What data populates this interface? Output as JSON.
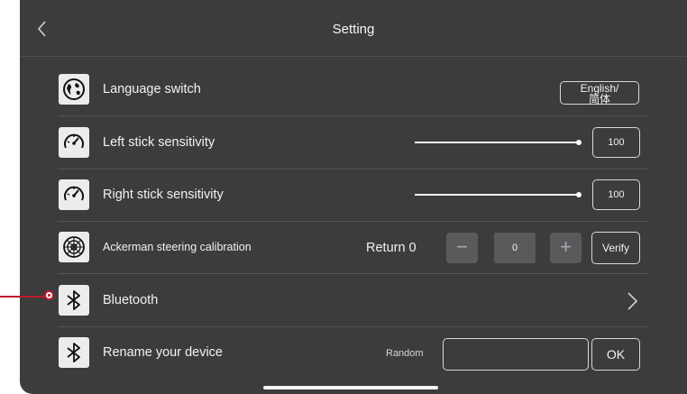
{
  "header": {
    "title": "Setting",
    "back_icon": "chevron-left-icon"
  },
  "rows": {
    "language": {
      "icon": "globe-icon",
      "label": "Language switch",
      "button_label": "English/\n简体"
    },
    "left_stick": {
      "icon": "speedometer-icon",
      "label": "Left stick sensitivity",
      "slider_value": 1.0,
      "value": "100"
    },
    "right_stick": {
      "icon": "speedometer-icon",
      "label": "Right stick sensitivity",
      "slider_value": 1.0,
      "value": "100"
    },
    "ackerman": {
      "icon": "steering-wheel-icon",
      "label": "Ackerman steering calibration",
      "return_label": "Return 0",
      "minus": "−",
      "value": "0",
      "plus": "+",
      "verify_label": "Verify"
    },
    "bluetooth": {
      "icon": "bluetooth-icon",
      "label": "Bluetooth",
      "chevron_icon": "chevron-right-icon"
    },
    "rename": {
      "icon": "bluetooth-icon",
      "label": "Rename your device",
      "random_label": "Random",
      "input_value": "",
      "ok_label": "OK"
    }
  },
  "colors": {
    "background": "#3c3c3e",
    "annotation": "#c2182a",
    "icon_tile": "#ececec"
  }
}
